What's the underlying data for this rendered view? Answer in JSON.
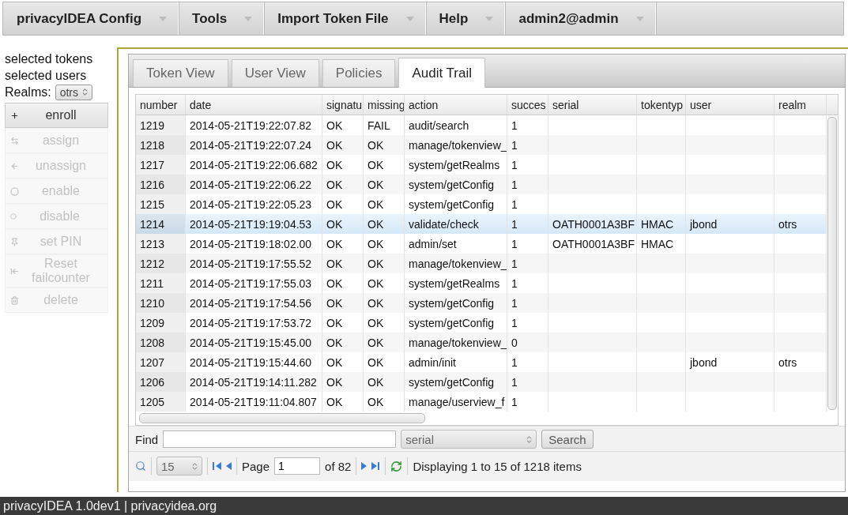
{
  "menu": [
    {
      "label": "privacyIDEA Config"
    },
    {
      "label": "Tools"
    },
    {
      "label": "Import Token File"
    },
    {
      "label": "Help"
    },
    {
      "label": "admin2@admin"
    }
  ],
  "sidebar": {
    "selected_tokens": "selected tokens",
    "selected_users": "selected users",
    "realms_label": "Realms:",
    "realm_value": "otrs",
    "actions": [
      {
        "label": "enroll",
        "disabled": false
      },
      {
        "label": "assign",
        "disabled": true
      },
      {
        "label": "unassign",
        "disabled": true
      },
      {
        "label": "enable",
        "disabled": true
      },
      {
        "label": "disable",
        "disabled": true
      },
      {
        "label": "set PIN",
        "disabled": true
      },
      {
        "label": "Reset failcounter",
        "disabled": true
      },
      {
        "label": "delete",
        "disabled": true
      }
    ]
  },
  "tabs": [
    {
      "label": "Token View",
      "selected": false
    },
    {
      "label": "User View",
      "selected": false
    },
    {
      "label": "Policies",
      "selected": false
    },
    {
      "label": "Audit Trail",
      "selected": true
    }
  ],
  "table": {
    "columns": [
      "number",
      "date",
      "signatu",
      "missing",
      "action",
      "succes",
      "serial",
      "tokentyp",
      "user",
      "realm"
    ],
    "rows": [
      {
        "selected": false,
        "cells": [
          "1219",
          "2014-05-21T19:22:07.82",
          "OK",
          "FAIL",
          "audit/search",
          "1",
          null,
          null,
          null,
          null
        ]
      },
      {
        "selected": false,
        "cells": [
          "1218",
          "2014-05-21T19:22:07.24",
          "OK",
          "OK",
          "manage/tokenview_",
          "1",
          null,
          null,
          null,
          null
        ]
      },
      {
        "selected": false,
        "cells": [
          "1217",
          "2014-05-21T19:22:06.682",
          "OK",
          "OK",
          "system/getRealms",
          "1",
          null,
          null,
          null,
          null
        ]
      },
      {
        "selected": false,
        "cells": [
          "1216",
          "2014-05-21T19:22:06.22",
          "OK",
          "OK",
          "system/getConfig",
          "1",
          null,
          null,
          null,
          null
        ]
      },
      {
        "selected": false,
        "cells": [
          "1215",
          "2014-05-21T19:22:05.23",
          "OK",
          "OK",
          "system/getConfig",
          "1",
          null,
          null,
          null,
          null
        ]
      },
      {
        "selected": true,
        "cells": [
          "1214",
          "2014-05-21T19:19:04.53",
          "OK",
          "OK",
          "validate/check",
          "1",
          "OATH0001A3BF",
          "HMAC",
          "jbond",
          "otrs"
        ]
      },
      {
        "selected": false,
        "cells": [
          "1213",
          "2014-05-21T19:18:02.00",
          "OK",
          "OK",
          "admin/set",
          "1",
          "OATH0001A3BF",
          "HMAC",
          null,
          null
        ]
      },
      {
        "selected": false,
        "cells": [
          "1212",
          "2014-05-21T19:17:55.52",
          "OK",
          "OK",
          "manage/tokenview_",
          "1",
          null,
          null,
          null,
          null
        ]
      },
      {
        "selected": false,
        "cells": [
          "1211",
          "2014-05-21T19:17:55.03",
          "OK",
          "OK",
          "system/getRealms",
          "1",
          null,
          null,
          null,
          null
        ]
      },
      {
        "selected": false,
        "cells": [
          "1210",
          "2014-05-21T19:17:54.56",
          "OK",
          "OK",
          "system/getConfig",
          "1",
          null,
          null,
          null,
          null
        ]
      },
      {
        "selected": false,
        "cells": [
          "1209",
          "2014-05-21T19:17:53.72",
          "OK",
          "OK",
          "system/getConfig",
          "1",
          null,
          null,
          null,
          null
        ]
      },
      {
        "selected": false,
        "cells": [
          "1208",
          "2014-05-21T19:15:45.00",
          "OK",
          "OK",
          "manage/tokenview_",
          "0",
          null,
          null,
          null,
          null
        ]
      },
      {
        "selected": false,
        "cells": [
          "1207",
          "2014-05-21T19:15:44.60",
          "OK",
          "OK",
          "admin/init",
          "1",
          null,
          null,
          "jbond",
          "otrs"
        ]
      },
      {
        "selected": false,
        "cells": [
          "1206",
          "2014-05-21T19:14:11.282",
          "OK",
          "OK",
          "system/getConfig",
          "1",
          null,
          null,
          null,
          null
        ]
      },
      {
        "selected": false,
        "cells": [
          "1205",
          "2014-05-21T19:11:04.807",
          "OK",
          "OK",
          "manage/userview_f",
          "1",
          null,
          null,
          null,
          null
        ]
      }
    ]
  },
  "find": {
    "label": "Find",
    "scope": "serial",
    "button": "Search"
  },
  "pager": {
    "page_size": "15",
    "page_label": "Page",
    "page": "1",
    "of": "of 82",
    "status": "Displaying 1 to 15 of 1218 items"
  },
  "footer": "privacyIDEA 1.0dev1 | privacyidea.org"
}
